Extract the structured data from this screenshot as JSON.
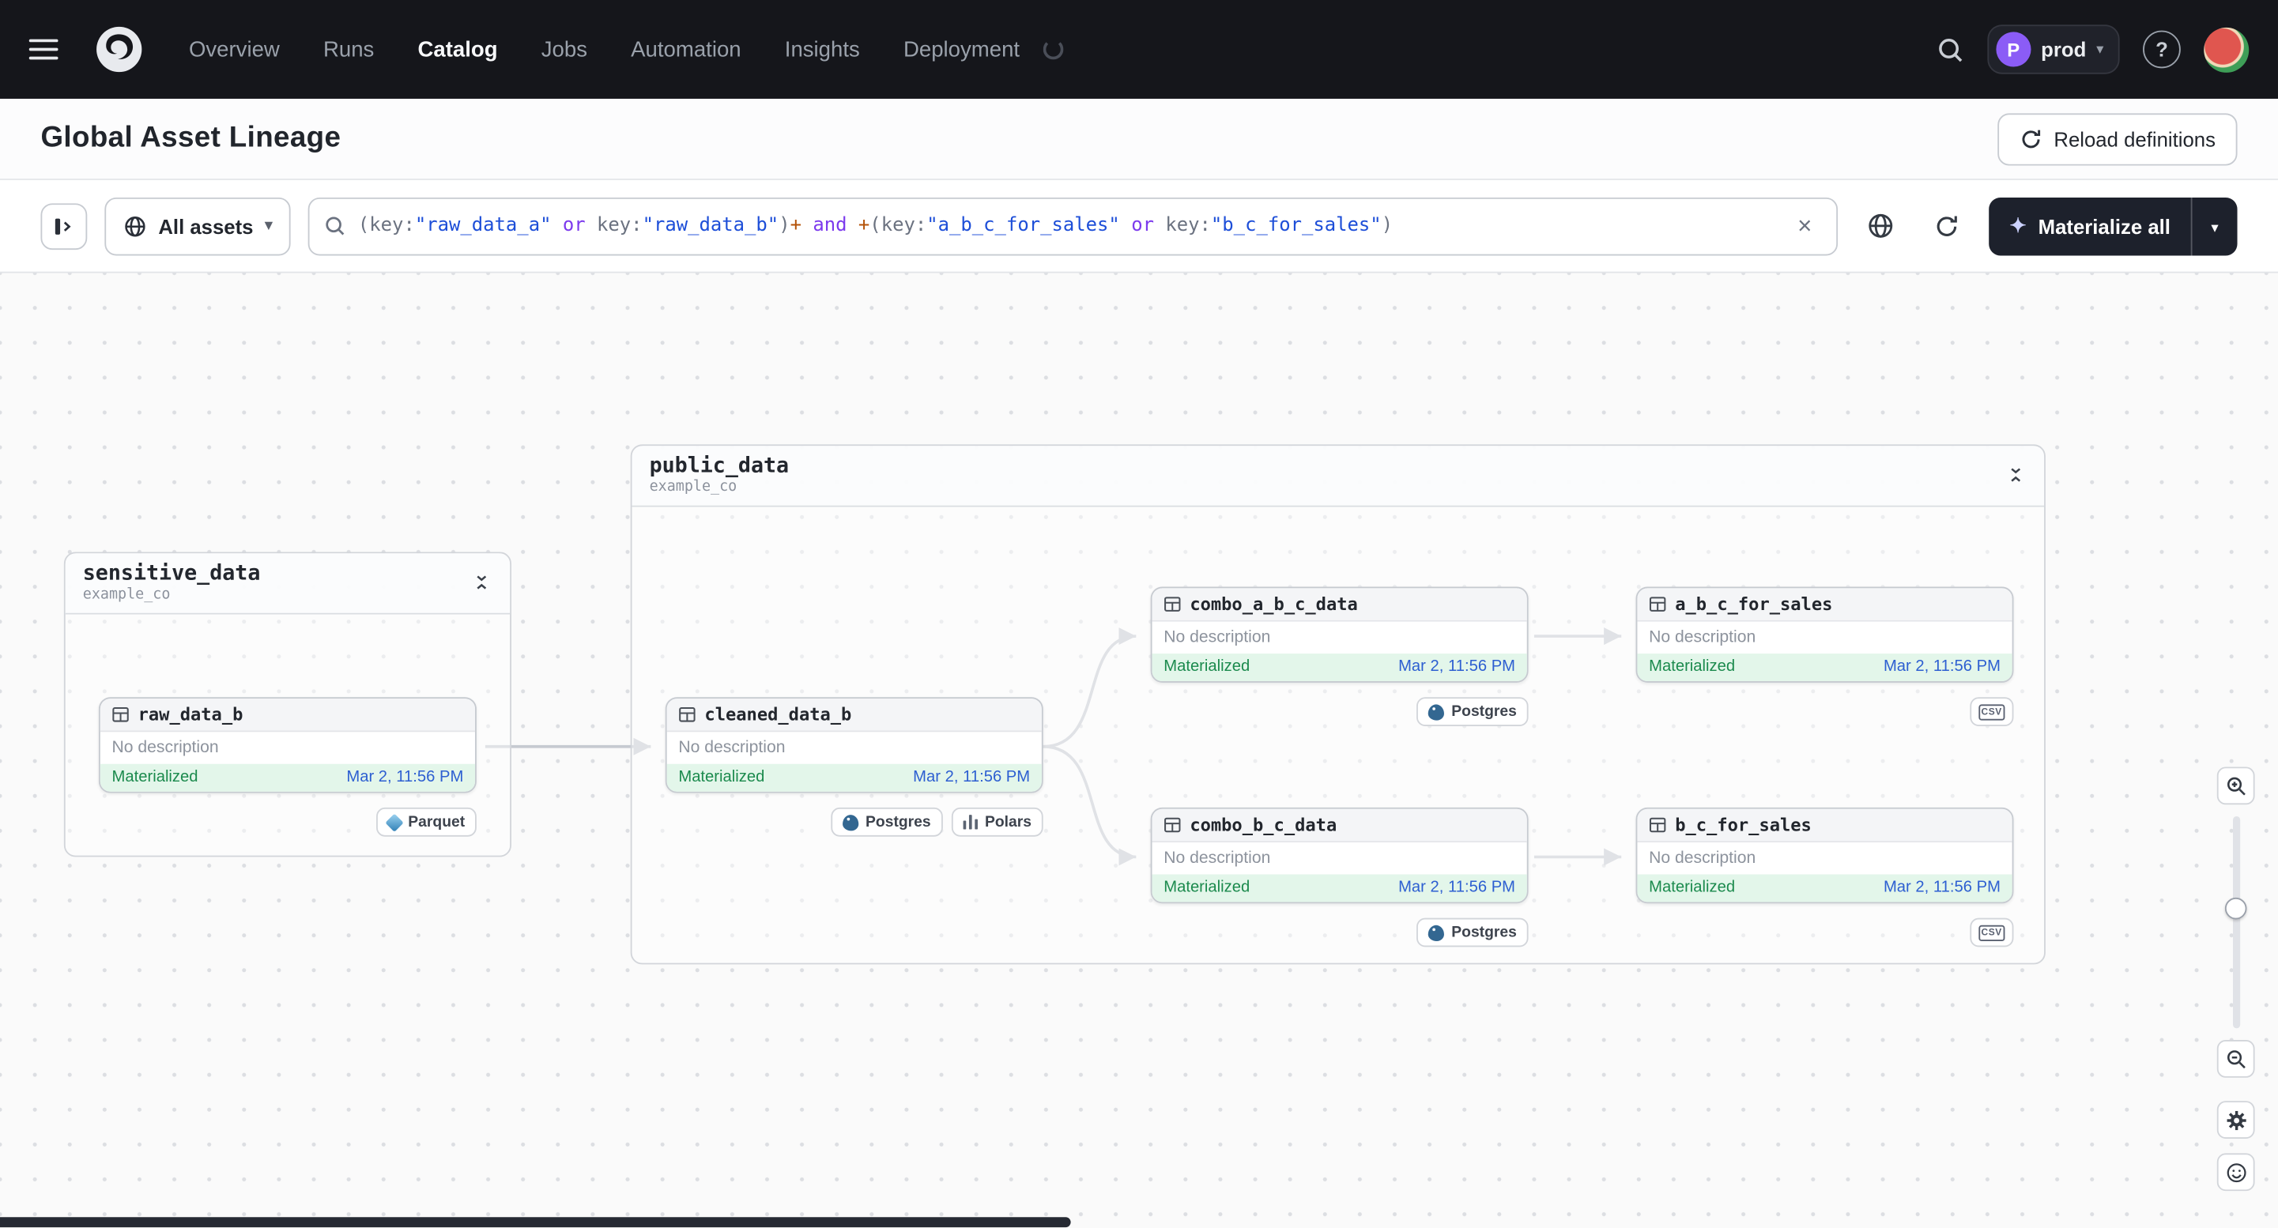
{
  "navbar": {
    "items": [
      "Overview",
      "Runs",
      "Catalog",
      "Jobs",
      "Automation",
      "Insights",
      "Deployment"
    ],
    "active_item": "Catalog",
    "deployment_switcher": {
      "initial": "P",
      "name": "prod"
    },
    "help_label": "?"
  },
  "header": {
    "title": "Global Asset Lineage",
    "reload_button_label": "Reload definitions"
  },
  "toolbar": {
    "asset_filter_label": "All assets",
    "clear_button": "×",
    "materialize_button_label": "Materialize all",
    "query_tokens": [
      {
        "t": "(",
        "c": "#6b7280"
      },
      {
        "t": "key:",
        "c": "#6b7280"
      },
      {
        "t": "\"raw_data_a\"",
        "c": "#1d4ed8"
      },
      {
        "t": " or ",
        "c": "#7c3aed"
      },
      {
        "t": "key:",
        "c": "#6b7280"
      },
      {
        "t": "\"raw_data_b\"",
        "c": "#1d4ed8"
      },
      {
        "t": ")",
        "c": "#6b7280"
      },
      {
        "t": "+",
        "c": "#b45309"
      },
      {
        "t": " and ",
        "c": "#7c3aed"
      },
      {
        "t": "+",
        "c": "#b45309"
      },
      {
        "t": "(",
        "c": "#6b7280"
      },
      {
        "t": "key:",
        "c": "#6b7280"
      },
      {
        "t": "\"a_b_c_for_sales\"",
        "c": "#1d4ed8"
      },
      {
        "t": " or ",
        "c": "#7c3aed"
      },
      {
        "t": "key:",
        "c": "#6b7280"
      },
      {
        "t": "\"b_c_for_sales\"",
        "c": "#1d4ed8"
      },
      {
        "t": ")",
        "c": "#6b7280"
      }
    ]
  },
  "graph": {
    "groups": [
      {
        "name": "sensitive_data",
        "subtitle": "example_co"
      },
      {
        "name": "public_data",
        "subtitle": "example_co"
      }
    ],
    "nodes": [
      {
        "name": "raw_data_b",
        "description": "No description",
        "status": "Materialized",
        "timestamp": "Mar 2, 11:56 PM",
        "kinds": [
          "Parquet"
        ]
      },
      {
        "name": "cleaned_data_b",
        "description": "No description",
        "status": "Materialized",
        "timestamp": "Mar 2, 11:56 PM",
        "kinds": [
          "Postgres",
          "Polars"
        ]
      },
      {
        "name": "combo_a_b_c_data",
        "description": "No description",
        "status": "Materialized",
        "timestamp": "Mar 2, 11:56 PM",
        "kinds": [
          "Postgres"
        ]
      },
      {
        "name": "a_b_c_for_sales",
        "description": "No description",
        "status": "Materialized",
        "timestamp": "Mar 2, 11:56 PM",
        "kinds": [
          "csv"
        ]
      },
      {
        "name": "combo_b_c_data",
        "description": "No description",
        "status": "Materialized",
        "timestamp": "Mar 2, 11:56 PM",
        "kinds": [
          "Postgres"
        ]
      },
      {
        "name": "b_c_for_sales",
        "description": "No description",
        "status": "Materialized",
        "timestamp": "Mar 2, 11:56 PM",
        "kinds": [
          "csv"
        ]
      }
    ]
  },
  "colors": {
    "navbar_bg": "#15161b",
    "accent_purple": "#8b5cf6",
    "materialized_text": "#1b8a4d",
    "materialized_bg": "#e3f6ea",
    "timestamp_link": "#2d5fd1",
    "dark_button_bg": "#1d212c"
  }
}
